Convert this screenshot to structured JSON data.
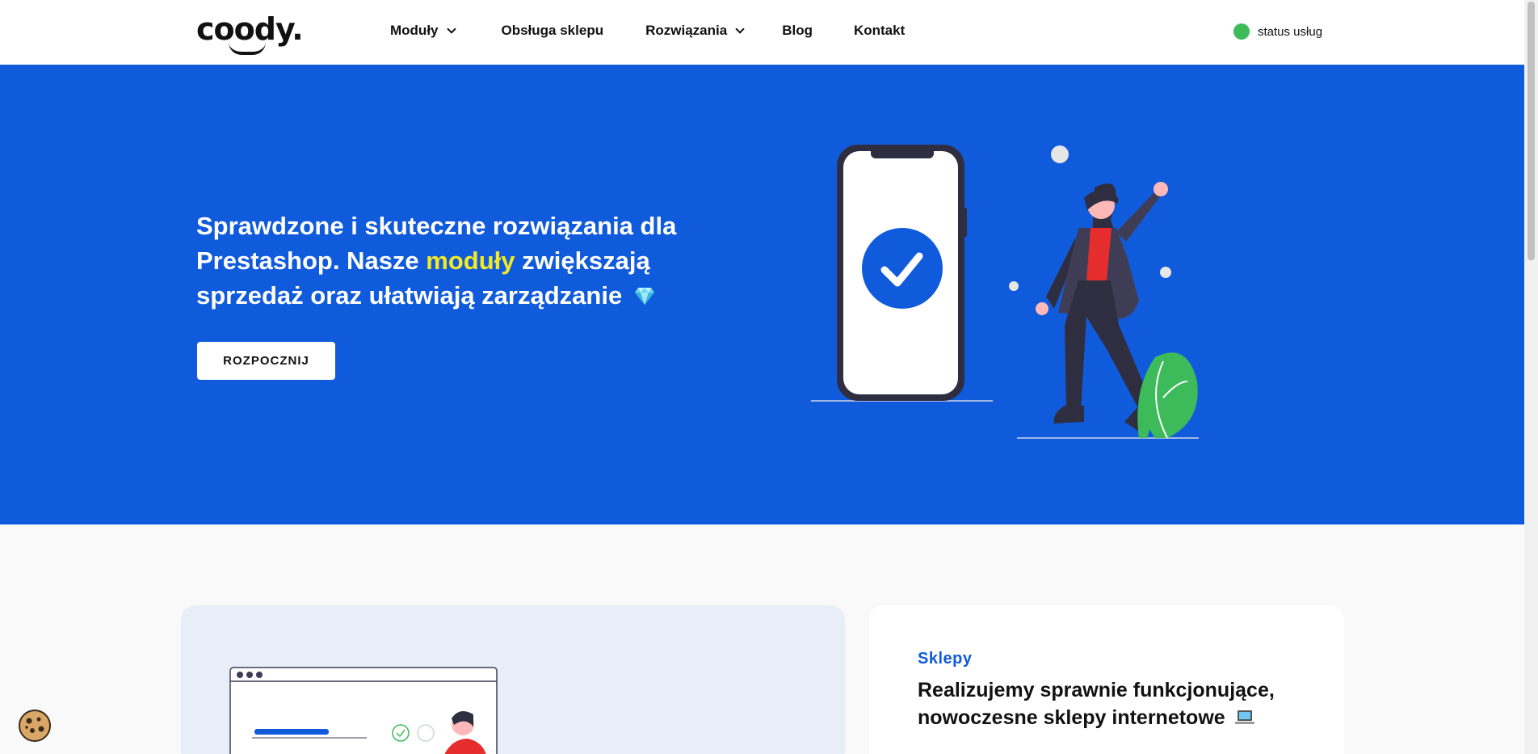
{
  "brand": {
    "logo": "coody"
  },
  "nav": {
    "items": [
      {
        "label": "Moduły",
        "has_dropdown": true
      },
      {
        "label": "Obsługa sklepu",
        "has_dropdown": false
      },
      {
        "label": "Rozwiązania",
        "has_dropdown": true
      },
      {
        "label": "Blog",
        "has_dropdown": false
      },
      {
        "label": "Kontakt",
        "has_dropdown": false
      }
    ]
  },
  "status": {
    "label": "status usług",
    "color": "#3dba5a"
  },
  "hero": {
    "title_part1": "Sprawdzone i skuteczne rozwiązania dla Prestashop. Nasze ",
    "title_highlight": "moduły",
    "title_part2": " zwiększają sprzedaż oraz ułatwiają zarządzanie",
    "gem_icon": "gem-icon",
    "cta_label": "ROZPOCZNIJ",
    "bg_color": "#105bdc",
    "highlight_color": "#f4e924"
  },
  "section": {
    "card": {
      "tag": "Sklepy",
      "title": "Realizujemy sprawnie funkcjonujące, nowoczesne sklepy internetowe",
      "laptop_icon": "laptop-icon"
    }
  },
  "cookie": {
    "icon": "cookie-icon"
  }
}
